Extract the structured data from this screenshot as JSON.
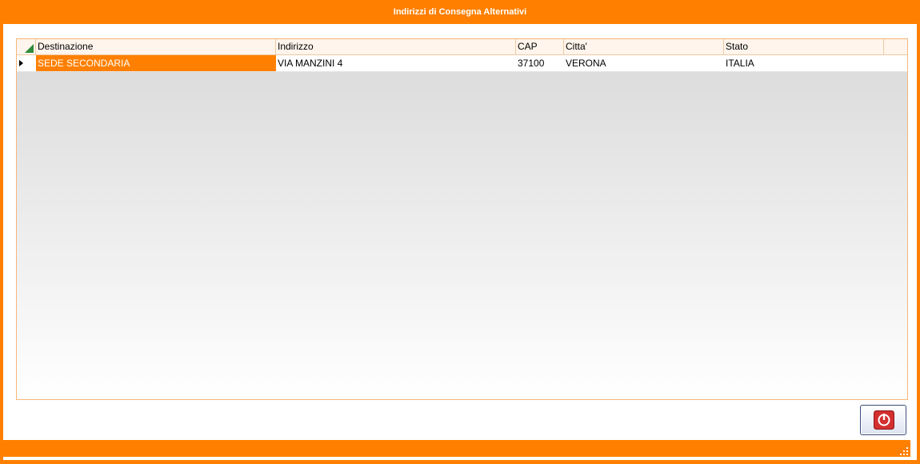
{
  "window": {
    "title": "Indirizzi di Consegna Alternativi"
  },
  "grid": {
    "columns": [
      "Destinazione",
      "Indirizzo",
      "CAP",
      "Citta'",
      "Stato"
    ],
    "rows": [
      [
        "SEDE SECONDARIA",
        "VIA MANZINI 4",
        "37100",
        "VERONA",
        "ITALIA"
      ]
    ]
  },
  "buttons": {
    "exit_icon": "power-icon"
  },
  "colors": {
    "accent": "#ff8000",
    "selection": "#ff8000",
    "grid_border": "#f5b57a"
  }
}
